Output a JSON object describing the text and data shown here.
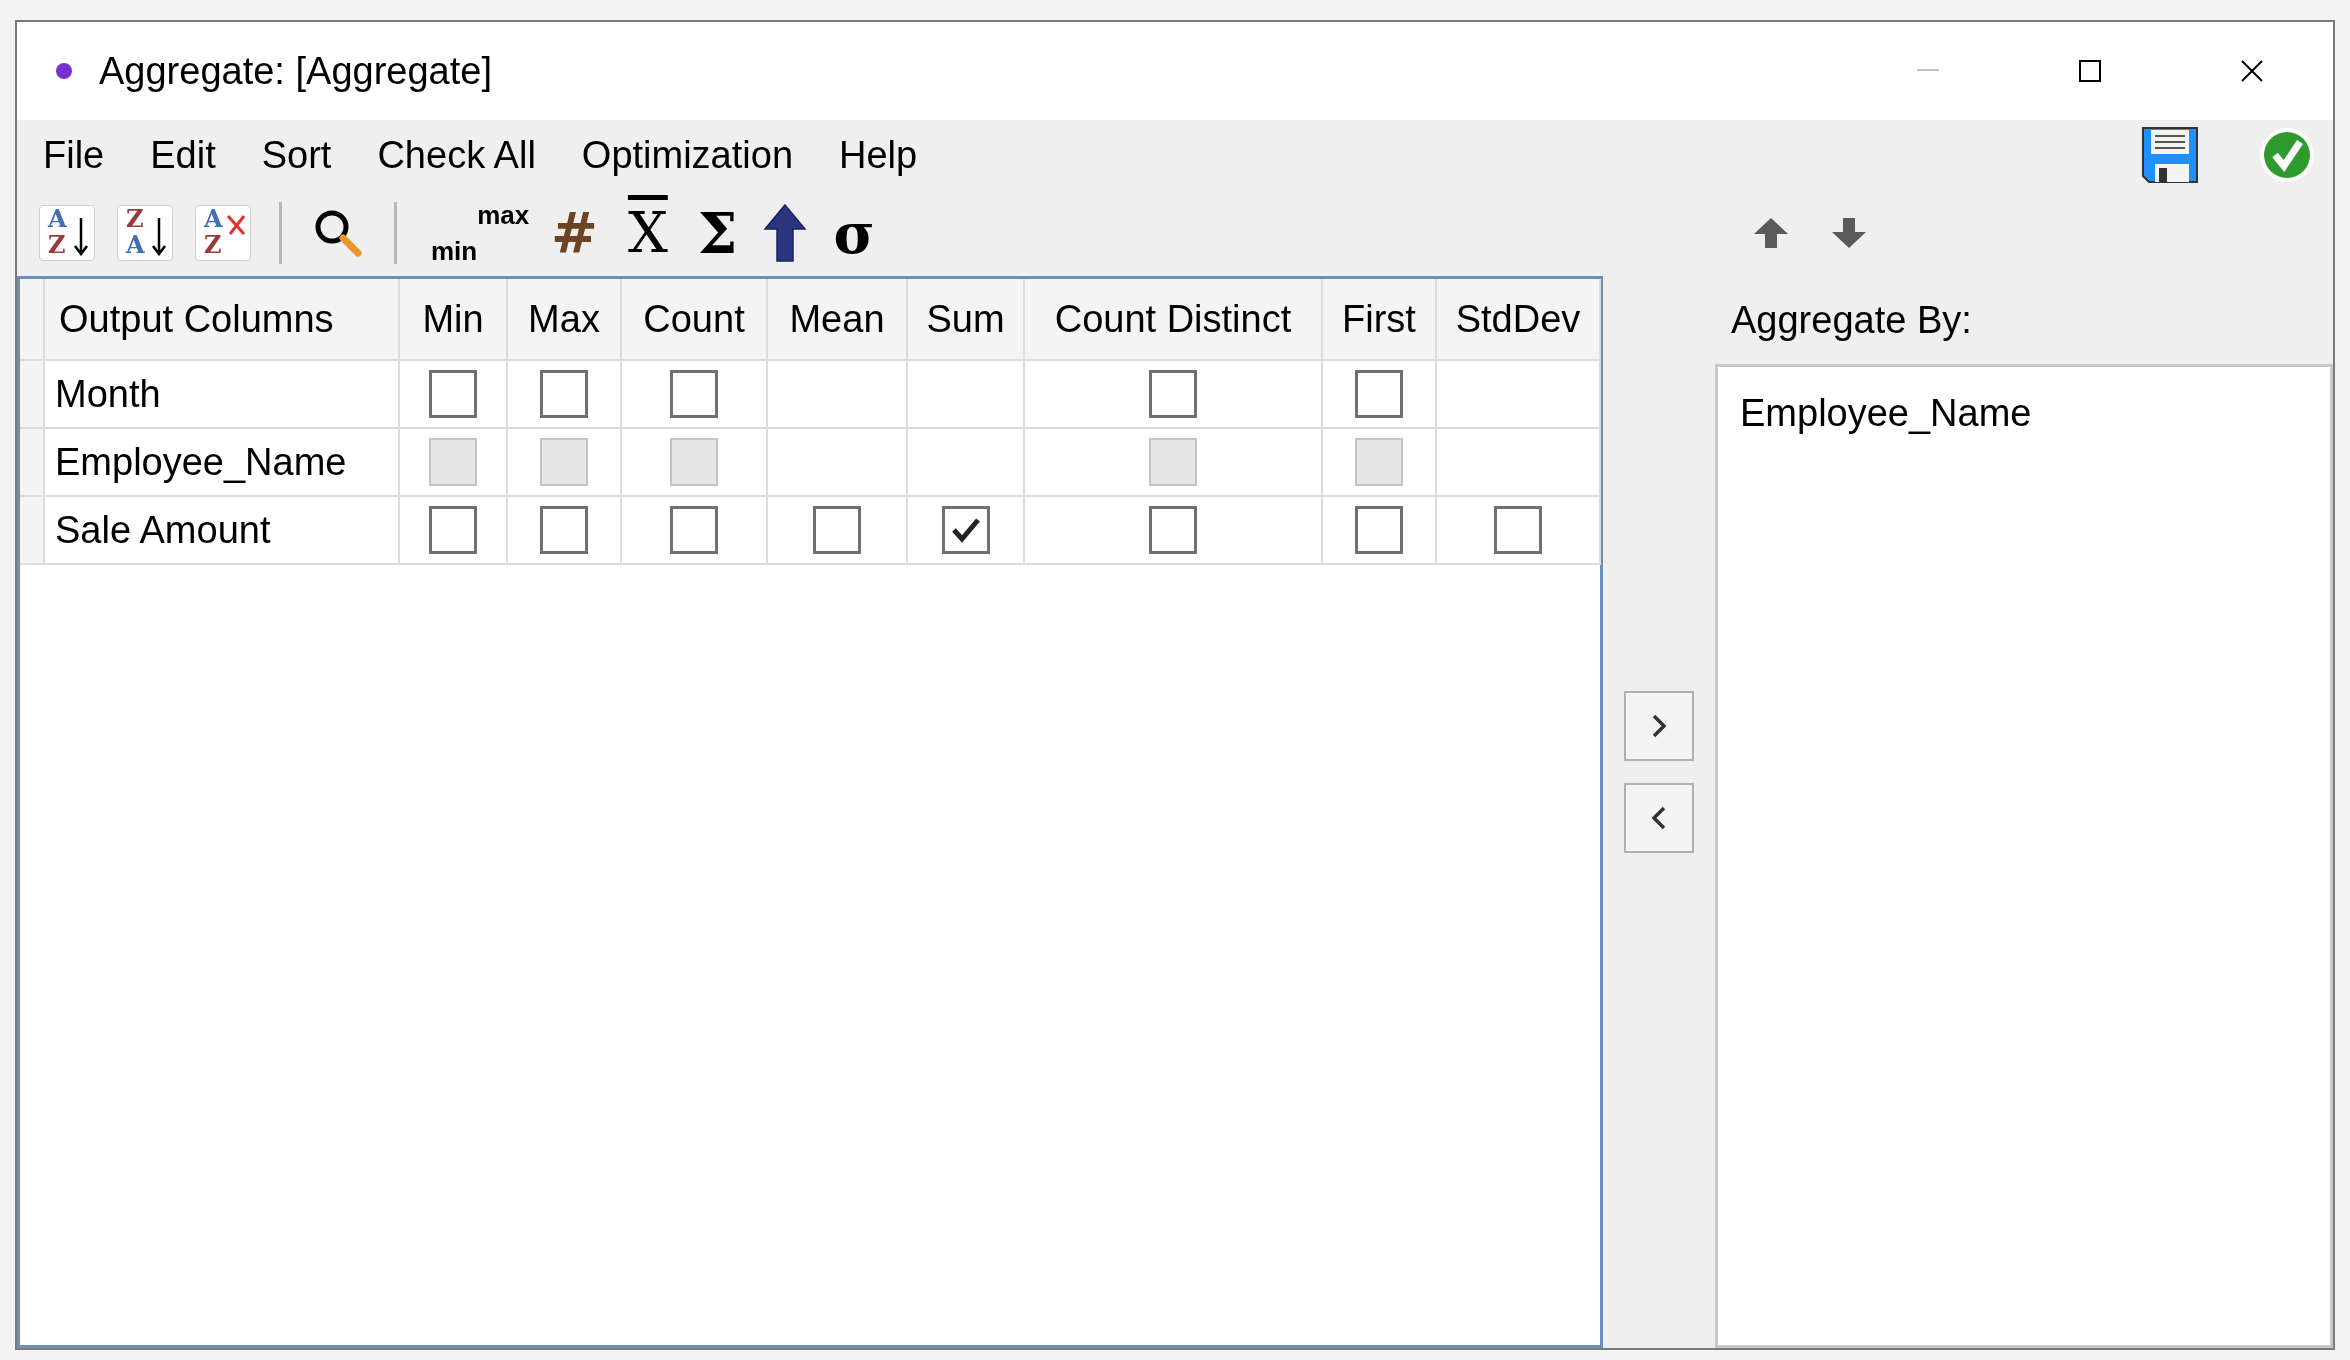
{
  "window": {
    "title": "Aggregate: [Aggregate]"
  },
  "menu": [
    "File",
    "Edit",
    "Sort",
    "Check All",
    "Optimization",
    "Help"
  ],
  "toolbar": [
    {
      "kind": "sort",
      "top": "A",
      "bottom": "Z"
    },
    {
      "kind": "sort",
      "top": "Z",
      "bottom": "A"
    },
    {
      "kind": "clear-sort",
      "top": "A",
      "bottom": "Z"
    },
    {
      "kind": "separator"
    },
    {
      "kind": "search"
    },
    {
      "kind": "separator"
    },
    {
      "kind": "minmax",
      "low": "min",
      "high": "max"
    },
    {
      "kind": "symbol",
      "text": "#",
      "color": "#6b4423"
    },
    {
      "kind": "mean",
      "text": "X"
    },
    {
      "kind": "symbol",
      "text": "Σ",
      "color": "#000000"
    },
    {
      "kind": "up-arrow"
    },
    {
      "kind": "symbol",
      "text": "σ",
      "color": "#000000"
    }
  ],
  "table": {
    "columns": [
      "Output Columns",
      "Min",
      "Max",
      "Count",
      "Mean",
      "Sum",
      "Count Distinct",
      "First",
      "StdDev"
    ],
    "rows": [
      {
        "name": "Month",
        "cells": [
          {
            "kind": "checkbox",
            "checked": false,
            "disabled": false
          },
          {
            "kind": "checkbox",
            "checked": false,
            "disabled": false
          },
          {
            "kind": "checkbox",
            "checked": false,
            "disabled": false
          },
          {
            "kind": "none"
          },
          {
            "kind": "none"
          },
          {
            "kind": "checkbox",
            "checked": false,
            "disabled": false
          },
          {
            "kind": "checkbox",
            "checked": false,
            "disabled": false
          },
          {
            "kind": "none"
          }
        ]
      },
      {
        "name": "Employee_Name",
        "cells": [
          {
            "kind": "checkbox",
            "checked": false,
            "disabled": true
          },
          {
            "kind": "checkbox",
            "checked": false,
            "disabled": true
          },
          {
            "kind": "checkbox",
            "checked": false,
            "disabled": true
          },
          {
            "kind": "none"
          },
          {
            "kind": "none"
          },
          {
            "kind": "checkbox",
            "checked": false,
            "disabled": true
          },
          {
            "kind": "checkbox",
            "checked": false,
            "disabled": true
          },
          {
            "kind": "none"
          }
        ]
      },
      {
        "name": "Sale Amount",
        "cells": [
          {
            "kind": "checkbox",
            "checked": false,
            "disabled": false
          },
          {
            "kind": "checkbox",
            "checked": false,
            "disabled": false
          },
          {
            "kind": "checkbox",
            "checked": false,
            "disabled": false
          },
          {
            "kind": "checkbox",
            "checked": false,
            "disabled": false
          },
          {
            "kind": "checkbox",
            "checked": true,
            "disabled": false
          },
          {
            "kind": "checkbox",
            "checked": false,
            "disabled": false
          },
          {
            "kind": "checkbox",
            "checked": false,
            "disabled": false
          },
          {
            "kind": "checkbox",
            "checked": false,
            "disabled": false
          }
        ]
      }
    ]
  },
  "aggregate_by": {
    "label": "Aggregate By:",
    "items": [
      "Employee_Name"
    ]
  }
}
